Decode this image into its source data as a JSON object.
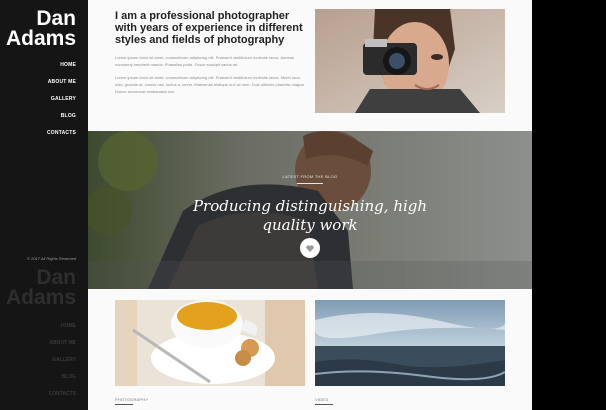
{
  "sidebar": {
    "logo_line1": "Dan",
    "logo_line2": "Adams",
    "nav": [
      "HOME",
      "ABOUT ME",
      "GALLERY",
      "BLOG",
      "CONTACTS"
    ],
    "copyright": "© 2017 All Rights Reserved",
    "logo2_line1": "Dan",
    "logo2_line2": "Adams",
    "nav2": [
      "HOME",
      "ABOUT ME",
      "GALLERY",
      "BLOG",
      "CONTACTS"
    ]
  },
  "intro": {
    "heading": "I am a professional photographer with years of experience in different styles and fields of photography",
    "para1": "Lorem ipsum dolor sit amet, consectetuer adipiscing elit. Praesent vestibulum molestie lacus. Aenean nonummy hendrerit mauris. Phasellus porta. Fusce suscipit varius mi.",
    "para2": "Lorem ipsum dolor sit amet, consectetuer adipiscing elit. Praesent vestibulum molestie lacus. Morbi nunc odio, gravida at, cursus nec, luctus a, lorem. Maecenas tristique orci ac sem. Duis ultricies pharetra magna. Donec accumsan malesuada orci."
  },
  "hero": {
    "tag": "LATEST FROM THE BLOG",
    "title": "Producing distinguishing, high quality work",
    "button_icon": "heart-icon"
  },
  "cards": [
    {
      "caption": "PHOTOGRAPHY"
    },
    {
      "caption": "VIDEO"
    }
  ],
  "colors": {
    "sidebar": "#151515",
    "main": "#fafafa",
    "text_dark": "#222222",
    "accent": "#ffffff"
  }
}
